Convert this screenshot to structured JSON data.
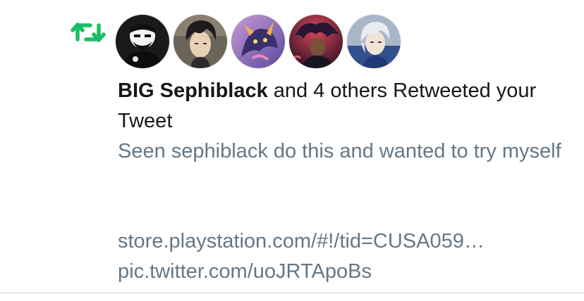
{
  "notification": {
    "user_name": "BIG Sephiblack",
    "action_text": " and 4 others Retweeted your Tweet",
    "tweet_text": "Seen sephiblack do this and wanted to try myself",
    "links": [
      "store.playstation.com/#!/tid=CUSA059…",
      "pic.twitter.com/uoJRTApoBs"
    ],
    "icon": "retweet-icon",
    "accent_color": "#17bf63",
    "avatars": [
      {
        "icon": "avatar-1"
      },
      {
        "icon": "avatar-2"
      },
      {
        "icon": "avatar-3"
      },
      {
        "icon": "avatar-4"
      },
      {
        "icon": "avatar-5"
      }
    ]
  }
}
